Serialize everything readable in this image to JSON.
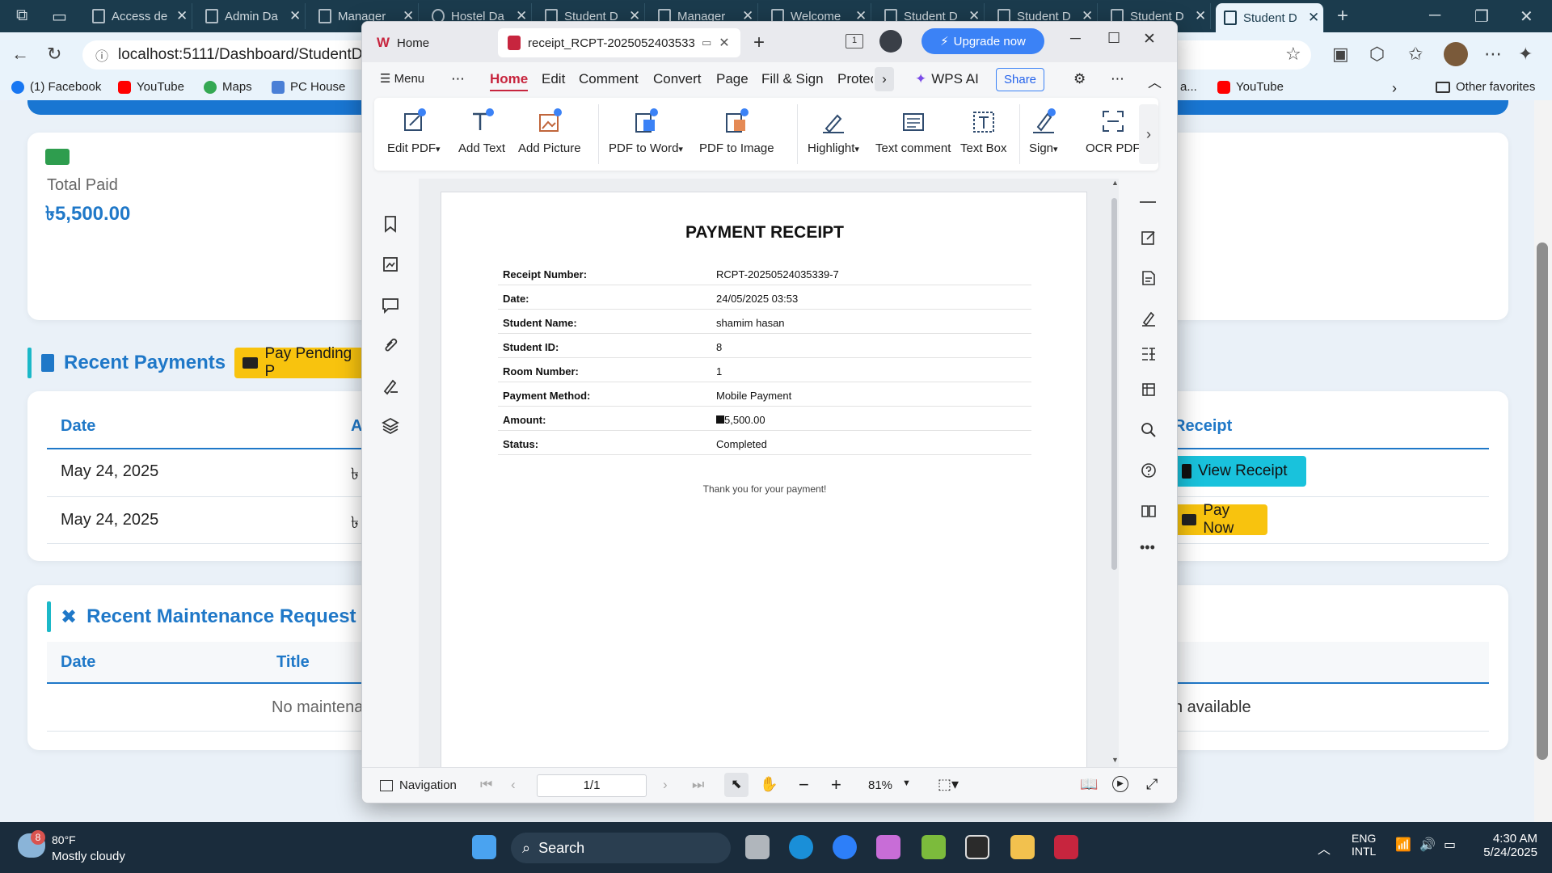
{
  "browser": {
    "tabs": [
      {
        "label": "Access de"
      },
      {
        "label": "Admin Da"
      },
      {
        "label": "Manager"
      },
      {
        "label": "Hostel Da"
      },
      {
        "label": "Student D"
      },
      {
        "label": "Manager"
      },
      {
        "label": "Welcome"
      },
      {
        "label": "Student D"
      },
      {
        "label": "Student D"
      },
      {
        "label": "Student D"
      },
      {
        "label": "Student D"
      }
    ],
    "url": "localhost:5111/Dashboard/StudentDash",
    "favorites": [
      {
        "label": "(1) Facebook"
      },
      {
        "label": "YouTube"
      },
      {
        "label": "Maps"
      },
      {
        "label": "PC House"
      },
      {
        "label": "a..."
      },
      {
        "label": "YouTube"
      }
    ],
    "other_favorites": "Other favorites"
  },
  "dashboard": {
    "total_paid": {
      "label": "Total Paid",
      "value": "৳5,500.00"
    },
    "recent_payments": {
      "title": "Recent Payments",
      "pay_pending_button": "Pay Pending P",
      "headers": {
        "date": "Date",
        "amount": "A",
        "receipt": "Receipt"
      },
      "rows": [
        {
          "date": "May 24, 2025",
          "amount": "৳",
          "action": "View Receipt"
        },
        {
          "date": "May 24, 2025",
          "amount": "৳",
          "action": "Pay Now"
        }
      ]
    },
    "recent_maintenance": {
      "title": "Recent Maintenance Request",
      "headers": {
        "date": "Date",
        "title": "Title"
      },
      "empty_left": "No maintena",
      "empty_right": "n available"
    }
  },
  "wps": {
    "home_tab": "Home",
    "doc_tab": "receipt_RCPT-2025052403533",
    "page_badge": "1",
    "upgrade": "Upgrade now",
    "menu": {
      "menu_label": "Menu",
      "items": [
        "Home",
        "Edit",
        "Comment",
        "Convert",
        "Page",
        "Fill & Sign",
        "Protec"
      ],
      "wps_ai": "WPS AI",
      "share": "Share"
    },
    "ribbon": [
      {
        "label": "Edit PDF",
        "dropdown": "▾"
      },
      {
        "label": "Add Text"
      },
      {
        "label": "Add Picture"
      },
      {
        "label": "PDF to Word",
        "dropdown": "▾"
      },
      {
        "label": "PDF to Image"
      },
      {
        "label": "Highlight",
        "dropdown": "▾"
      },
      {
        "label": "Text comment"
      },
      {
        "label": "Text Box"
      },
      {
        "label": "Sign",
        "dropdown": "▾"
      },
      {
        "label": "OCR PDF"
      }
    ],
    "status": {
      "navigation": "Navigation",
      "page": "1/1",
      "zoom": "81%"
    }
  },
  "receipt": {
    "title": "PAYMENT RECEIPT",
    "rows": [
      {
        "key": "Receipt Number:",
        "value": "RCPT-20250524035339-7"
      },
      {
        "key": "Date:",
        "value": "24/05/2025 03:53"
      },
      {
        "key": "Student Name:",
        "value": "shamim hasan"
      },
      {
        "key": "Student ID:",
        "value": "8"
      },
      {
        "key": "Room Number:",
        "value": "1"
      },
      {
        "key": "Payment Method:",
        "value": "Mobile Payment"
      },
      {
        "key": "Amount:",
        "value": "5,500.00"
      },
      {
        "key": "Status:",
        "value": "Completed"
      }
    ],
    "thanks": "Thank you for your payment!"
  },
  "taskbar": {
    "weather_temp": "80°F",
    "weather_desc": "Mostly cloudy",
    "weather_badge": "8",
    "search": "Search",
    "lang1": "ENG",
    "lang2": "INTL",
    "time": "4:30 AM",
    "date": "5/24/2025"
  },
  "colors": {
    "brand_blue": "#1f78c8",
    "accent_yellow": "#f8c30e",
    "accent_cyan": "#19c2dc",
    "wps_red": "#c7253e",
    "upgrade_blue": "#3b82f6"
  }
}
